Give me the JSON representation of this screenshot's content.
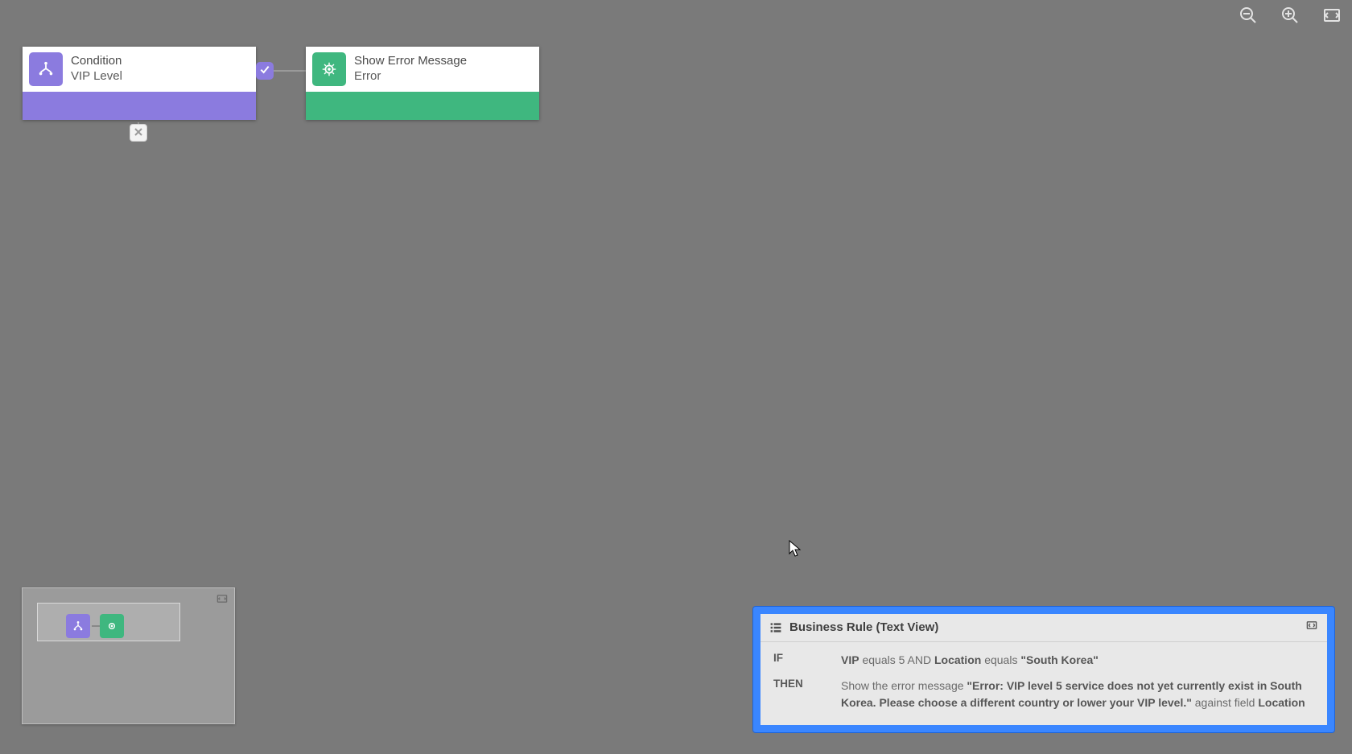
{
  "condition_node": {
    "title": "Condition",
    "subtitle": "VIP Level"
  },
  "action_node": {
    "title": "Show Error Message",
    "subtitle": "Error"
  },
  "text_view": {
    "title": "Business Rule (Text View)",
    "if_label": "IF",
    "then_label": "THEN",
    "if_parts": {
      "field1": "VIP",
      "op1": " equals 5 AND ",
      "field2": "Location",
      "op2": " equals ",
      "value2": "\"South Korea\""
    },
    "then_parts": {
      "prefix": "Show the error message ",
      "msg": "\"Error: VIP level 5 service does not yet currently exist in South Korea. Please choose a different country or lower your VIP level.\"",
      "mid": " against field ",
      "field": "Location"
    }
  }
}
